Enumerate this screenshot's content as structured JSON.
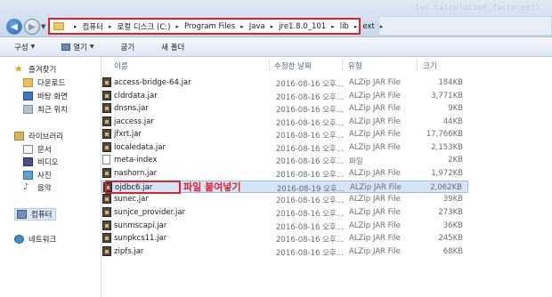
{
  "address": {
    "crumbs": [
      "컴퓨터",
      "로컬 디스크 (C:)",
      "Program Files",
      "Java",
      "jre1.8.0_101",
      "lib",
      "ext"
    ],
    "faint_text": "lvc.calculation_factores()"
  },
  "toolbar": {
    "organize": "구성",
    "open": "열기",
    "burn": "굽기",
    "new_folder": "새 폴더"
  },
  "sidebar": {
    "favorites": "즐겨찾기",
    "downloads": "다운로드",
    "desktop": "바탕 화면",
    "recent": "최근 위치",
    "libraries": "라이브러리",
    "documents": "문서",
    "videos": "비디오",
    "pictures": "사진",
    "music": "음악",
    "computer": "컴퓨터",
    "network": "네트워크"
  },
  "columns": {
    "name": "이름",
    "date": "수정한 날짜",
    "type": "유형",
    "size": "크기"
  },
  "files": [
    {
      "name": "access-bridge-64.jar",
      "date": "2016-08-16 오후...",
      "type": "ALZip JAR File",
      "size": "184KB"
    },
    {
      "name": "cldrdata.jar",
      "date": "2016-08-16 오후...",
      "type": "ALZip JAR File",
      "size": "3,771KB"
    },
    {
      "name": "dnsns.jar",
      "date": "2016-08-16 오후...",
      "type": "ALZip JAR File",
      "size": "9KB"
    },
    {
      "name": "jaccess.jar",
      "date": "2016-08-16 오후...",
      "type": "ALZip JAR File",
      "size": "44KB"
    },
    {
      "name": "jfxrt.jar",
      "date": "2016-08-16 오후...",
      "type": "ALZip JAR File",
      "size": "17,766KB"
    },
    {
      "name": "localedata.jar",
      "date": "2016-08-16 오후...",
      "type": "ALZip JAR File",
      "size": "2,153KB"
    },
    {
      "name": "meta-index",
      "date": "2016-08-16 오후...",
      "type": "파일",
      "size": "2KB"
    },
    {
      "name": "nashorn.jar",
      "date": "2016-08-16 오후...",
      "type": "ALZip JAR File",
      "size": "1,972KB"
    },
    {
      "name": "ojdbc6.jar",
      "date": "2016-08-19 오후...",
      "type": "ALZip JAR File",
      "size": "2,062KB"
    },
    {
      "name": "sunec.jar",
      "date": "2016-08-16 오후...",
      "type": "ALZip JAR File",
      "size": "39KB"
    },
    {
      "name": "sunjce_provider.jar",
      "date": "2016-08-16 오후...",
      "type": "ALZip JAR File",
      "size": "273KB"
    },
    {
      "name": "sunmscapi.jar",
      "date": "2016-08-16 오후...",
      "type": "ALZip JAR File",
      "size": "36KB"
    },
    {
      "name": "sunpkcs11.jar",
      "date": "2016-08-16 오후...",
      "type": "ALZip JAR File",
      "size": "245KB"
    },
    {
      "name": "zipfs.jar",
      "date": "2016-08-16 오후...",
      "type": "ALZip JAR File",
      "size": "68KB"
    }
  ],
  "annotation": "파일 붙여넣기",
  "colors": {
    "highlight_red": "#e0202a",
    "selection": "#d5e4f7"
  }
}
